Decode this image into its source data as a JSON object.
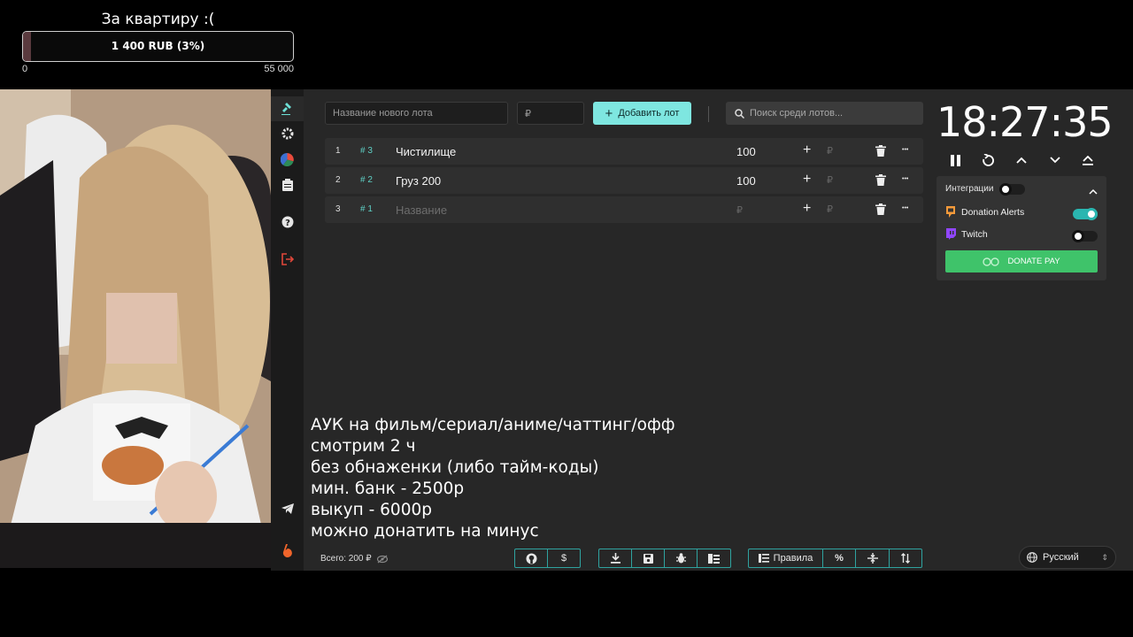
{
  "goal": {
    "title": "За квартиру :(",
    "amount_label": "1 400 RUB (3%)",
    "progress_fraction": 0.03,
    "min_label": "0",
    "max_label": "55 000",
    "fill_color": "#5a3a3e"
  },
  "sidebar": {
    "items": [
      {
        "name": "auction",
        "icon": "gavel-icon",
        "active": true
      },
      {
        "name": "settings",
        "icon": "gear-icon"
      },
      {
        "name": "wheel",
        "icon": "pie-chart-icon"
      },
      {
        "name": "history",
        "icon": "clipboard-icon"
      },
      {
        "name": "help",
        "icon": "question-icon"
      },
      {
        "name": "logout",
        "icon": "logout-icon"
      },
      {
        "name": "telegram",
        "icon": "telegram-icon"
      },
      {
        "name": "boosty",
        "icon": "boosty-icon"
      }
    ]
  },
  "toolbar": {
    "new_lot_placeholder": "Название нового лота",
    "amount_placeholder": "₽",
    "add_label": "Добавить лот",
    "search_placeholder": "Поиск среди лотов..."
  },
  "lots": [
    {
      "index": "1",
      "tag": "# 3",
      "name": "Чистилище",
      "amount": "100",
      "rub": "₽"
    },
    {
      "index": "2",
      "tag": "# 2",
      "name": "Груз 200",
      "amount": "100",
      "rub": "₽"
    },
    {
      "index": "3",
      "tag": "# 1",
      "name": "Название",
      "amount": "₽",
      "rub": "₽",
      "placeholder": true
    }
  ],
  "rules_overlay": [
    "АУК на фильм/сериал/аниме/чаттинг/офф",
    "смотрим 2 ч",
    "без обнаженки (либо тайм-коды)",
    "мин. банк - 2500р",
    "выкуп - 6000р",
    "можно донатить на минус"
  ],
  "footer": {
    "total_label": "Всего: 200 ₽",
    "rules_label": "Правила",
    "language": "Русский"
  },
  "timer": {
    "time": "18:27:35"
  },
  "integrations": {
    "title": "Интеграции",
    "donation_alerts": "Donation Alerts",
    "donation_alerts_enabled": true,
    "twitch": "Twitch",
    "twitch_enabled": false,
    "donate_pay": "DONATE PAY"
  },
  "colors": {
    "accent": "#7ee6e0",
    "teal": "#2ab6b0",
    "donate_pay_green": "#3fc36a",
    "panel": "#272727"
  }
}
